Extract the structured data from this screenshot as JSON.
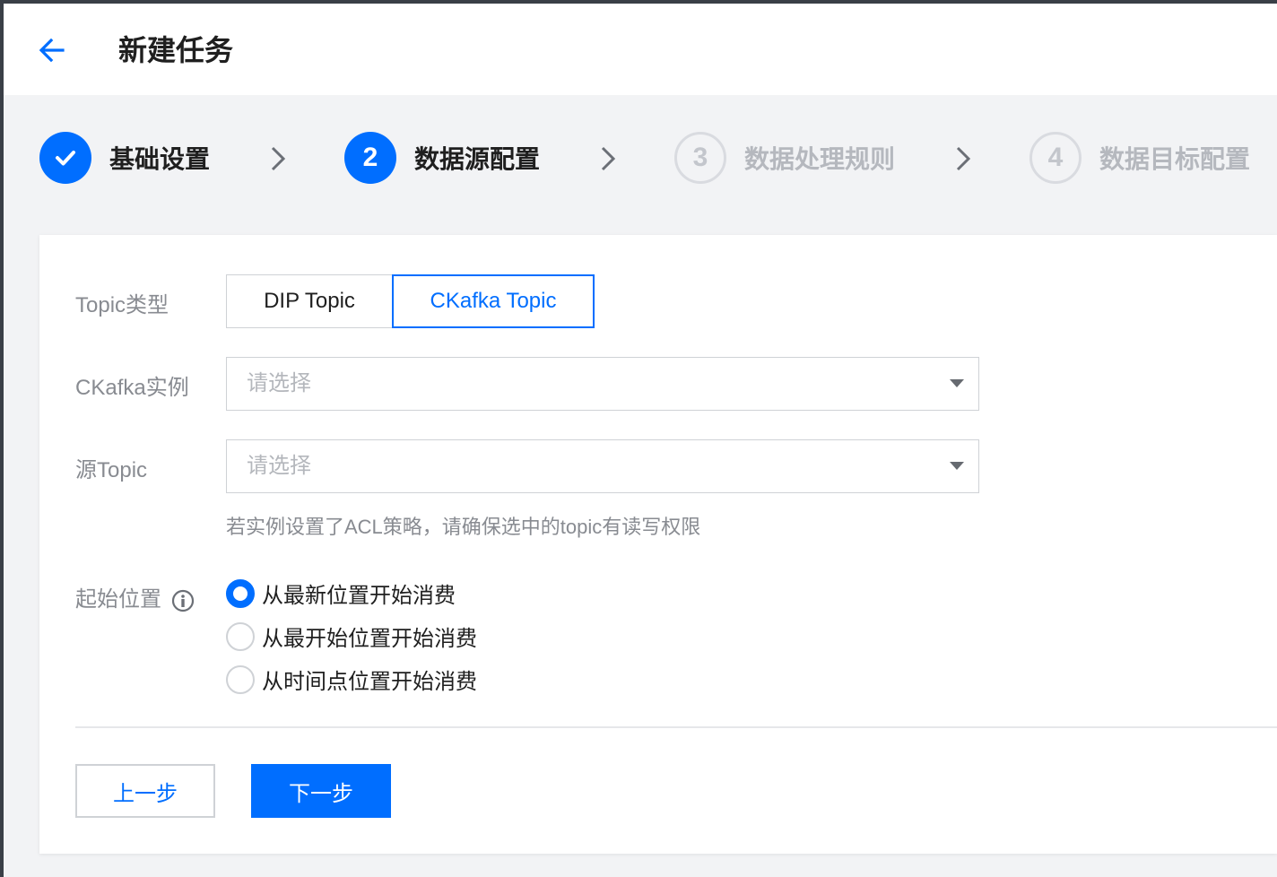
{
  "header": {
    "back_icon": "arrow-left-icon",
    "title": "新建任务"
  },
  "steps": [
    {
      "index": "1",
      "label": "基础设置",
      "status": "done"
    },
    {
      "index": "2",
      "label": "数据源配置",
      "status": "active"
    },
    {
      "index": "3",
      "label": "数据处理规则",
      "status": "pending"
    },
    {
      "index": "4",
      "label": "数据目标配置",
      "status": "pending"
    }
  ],
  "form": {
    "topic_type": {
      "label": "Topic类型",
      "options": [
        "DIP Topic",
        "CKafka Topic"
      ],
      "selected": "CKafka Topic"
    },
    "ckafka_instance": {
      "label": "CKafka实例",
      "placeholder": "请选择"
    },
    "source_topic": {
      "label": "源Topic",
      "placeholder": "请选择",
      "help": "若实例设置了ACL策略，请确保选中的topic有读写权限"
    },
    "start_position": {
      "label": "起始位置",
      "options": [
        "从最新位置开始消费",
        "从最开始位置开始消费",
        "从时间点位置开始消费"
      ],
      "selected": "从最新位置开始消费"
    }
  },
  "footer": {
    "prev_label": "上一步",
    "next_label": "下一步"
  },
  "colors": {
    "accent": "#006eff",
    "muted": "#888b91",
    "border": "#cfd2d6",
    "background": "#f2f3f5"
  }
}
